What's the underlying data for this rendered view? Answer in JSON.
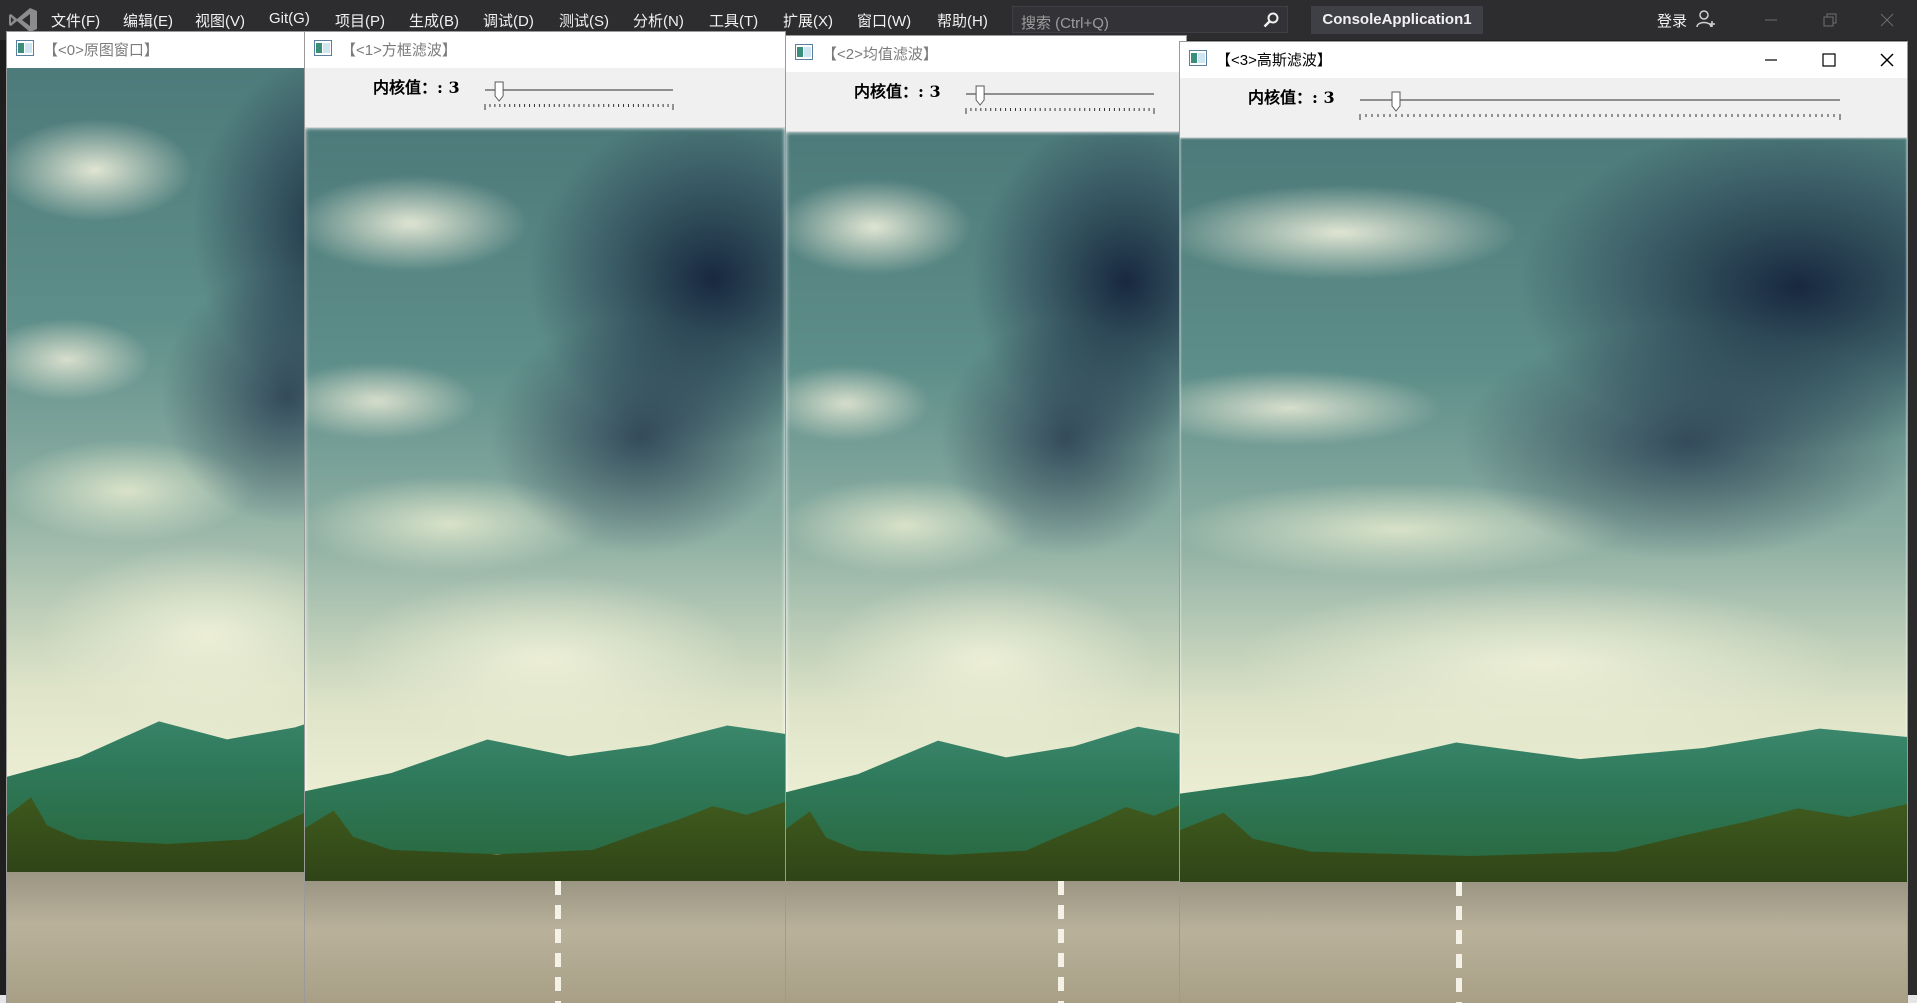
{
  "ide": {
    "menu_items": [
      "文件(F)",
      "编辑(E)",
      "视图(V)",
      "Git(G)",
      "项目(P)",
      "生成(B)",
      "调试(D)",
      "测试(S)",
      "分析(N)",
      "工具(T)",
      "扩展(X)",
      "窗口(W)",
      "帮助(H)"
    ],
    "search_placeholder": "搜索 (Ctrl+Q)",
    "project_name": "ConsoleApplication1",
    "login_label": "登录"
  },
  "windows": [
    {
      "title": "【<0>原图窗口】",
      "active": false
    },
    {
      "title": "【<1>方框滤波】",
      "active": false,
      "trackbar_label": "内核值：: 3",
      "trackbar_value": 3
    },
    {
      "title": "【<2>均值滤波】",
      "active": false,
      "trackbar_label": "内核值：: 3",
      "trackbar_value": 3
    },
    {
      "title": "【<3>高斯滤波】",
      "active": true,
      "trackbar_label": "内核值：: 3",
      "trackbar_value": 3
    }
  ],
  "colors": {
    "menubar_bg": "#2d2d30",
    "vs_logo": "#68217a",
    "trackbar_bg": "#f0f0f0"
  },
  "icons": [
    "visual-studio-logo-icon",
    "search-icon",
    "user-add-icon",
    "minimize-icon",
    "maximize-icon",
    "close-icon",
    "opencv-window-icon"
  ]
}
